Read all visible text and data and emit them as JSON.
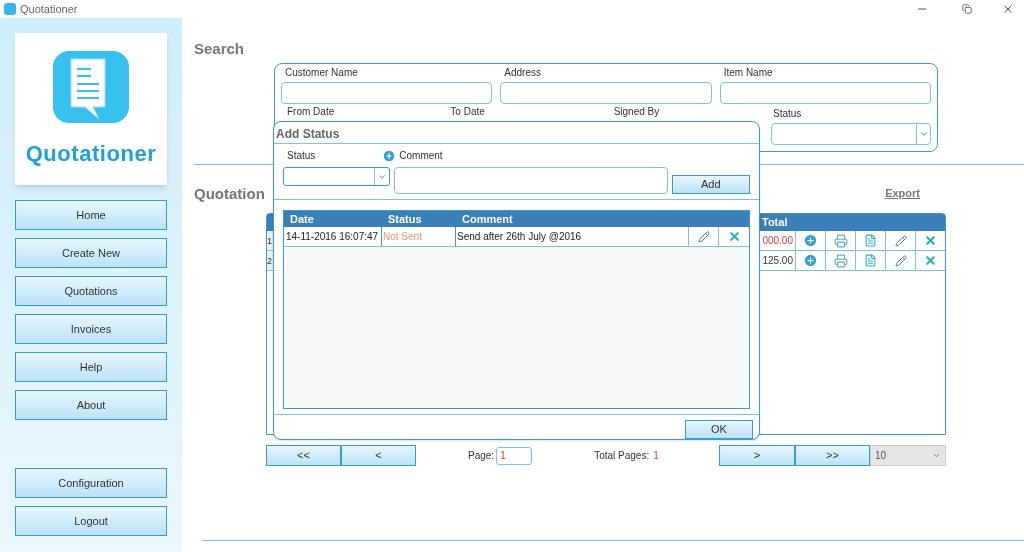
{
  "window": {
    "title": "Quotationer"
  },
  "sidebar": {
    "logo_text": "Quotationer",
    "nav": [
      {
        "label": "Home"
      },
      {
        "label": "Create New"
      },
      {
        "label": "Quotations"
      },
      {
        "label": "Invoices"
      },
      {
        "label": "Help"
      },
      {
        "label": "About"
      }
    ],
    "bottom_nav": [
      {
        "label": "Configuration"
      },
      {
        "label": "Logout"
      }
    ]
  },
  "search": {
    "title": "Search",
    "fields": [
      {
        "label": "Customer Name",
        "kind": "text"
      },
      {
        "label": "Address",
        "kind": "text"
      },
      {
        "label": "Item Name",
        "kind": "text"
      }
    ],
    "row2_labels": [
      "From Date",
      "To Date",
      "Signed By"
    ],
    "status_field": {
      "label": "Status",
      "kind": "select"
    }
  },
  "quotation": {
    "title": "Quotation",
    "export": "Export",
    "total_header": "Total",
    "rows": [
      {
        "number": "1",
        "total": "000.00",
        "highlighted": true
      },
      {
        "number": "2",
        "total": "125.00",
        "highlighted": false
      }
    ]
  },
  "pagination": {
    "first": "<<",
    "prev": "<",
    "page_label": "Page:",
    "page_value": "1",
    "total_label": "Total Pages:",
    "total_value": "1",
    "next": ">",
    "last": ">>",
    "page_size": "10"
  },
  "dialog": {
    "title": "Add Status",
    "status_label": "Status",
    "comment_label": "Comment",
    "add_button": "Add",
    "columns": [
      "Date",
      "Status",
      "Comment"
    ],
    "rows": [
      {
        "date": "14-11-2016 16:07:47",
        "status": "Not Sent",
        "color": "#f4936b",
        "comment": "Send after 26th July @2016"
      }
    ],
    "ok_button": "OK"
  }
}
